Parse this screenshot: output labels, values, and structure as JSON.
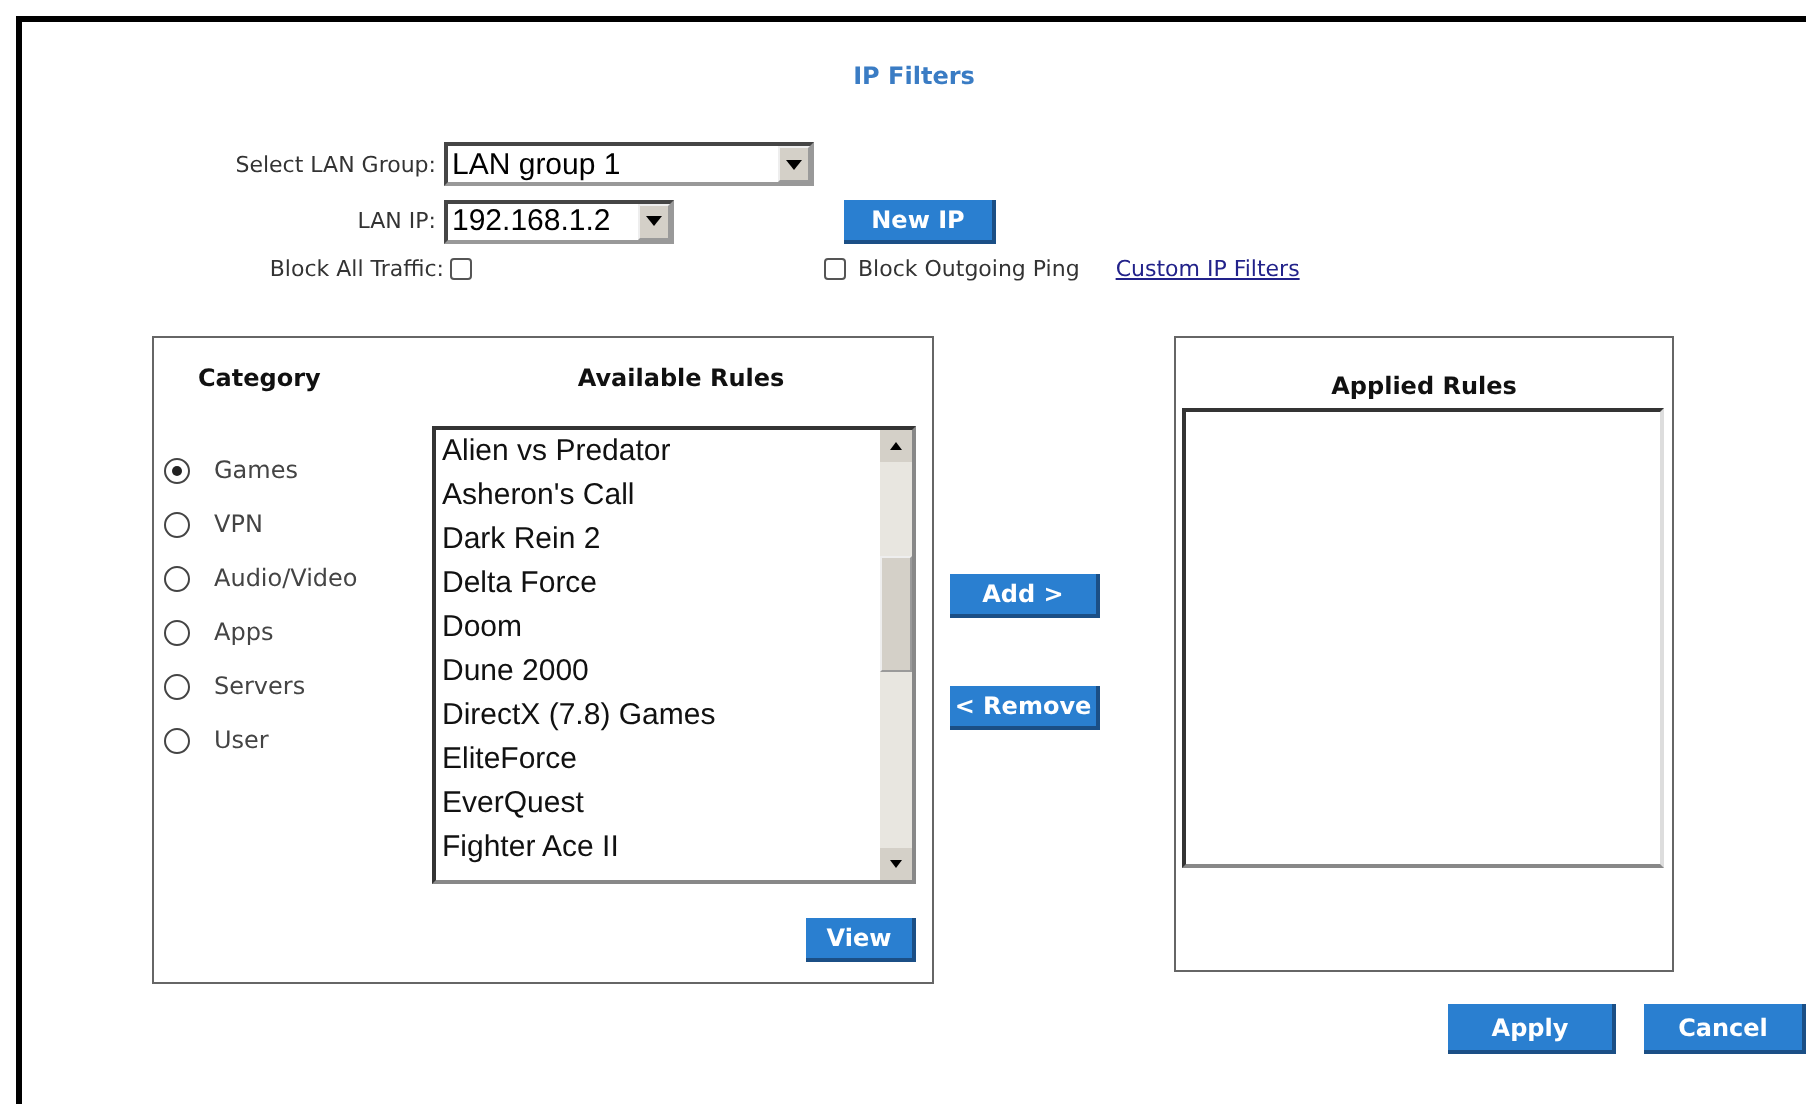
{
  "title": "IP Filters",
  "lan_group": {
    "label": "Select LAN Group:",
    "value": "LAN group 1"
  },
  "lan_ip": {
    "label": "LAN IP:",
    "value": "192.168.1.2"
  },
  "new_ip_button": "New IP",
  "block_all_traffic": {
    "label": "Block All Traffic:",
    "checked": false
  },
  "block_outgoing_ping": {
    "label": "Block Outgoing Ping",
    "checked": false
  },
  "custom_link": "Custom IP Filters",
  "category": {
    "heading": "Category",
    "items": [
      {
        "label": "Games",
        "selected": true
      },
      {
        "label": "VPN",
        "selected": false
      },
      {
        "label": "Audio/Video",
        "selected": false
      },
      {
        "label": "Apps",
        "selected": false
      },
      {
        "label": "Servers",
        "selected": false
      },
      {
        "label": "User",
        "selected": false
      }
    ]
  },
  "available_rules": {
    "heading": "Available Rules",
    "items": [
      "Alien vs Predator",
      "Asheron's Call",
      "Dark Rein 2",
      "Delta Force",
      "Doom",
      "Dune 2000",
      "DirectX (7.8) Games",
      "EliteForce",
      "EverQuest",
      "Fighter Ace II"
    ]
  },
  "view_button": "View",
  "add_button": "Add >",
  "remove_button": "< Remove",
  "applied_rules": {
    "heading": "Applied Rules"
  },
  "apply_button": "Apply",
  "cancel_button": "Cancel"
}
